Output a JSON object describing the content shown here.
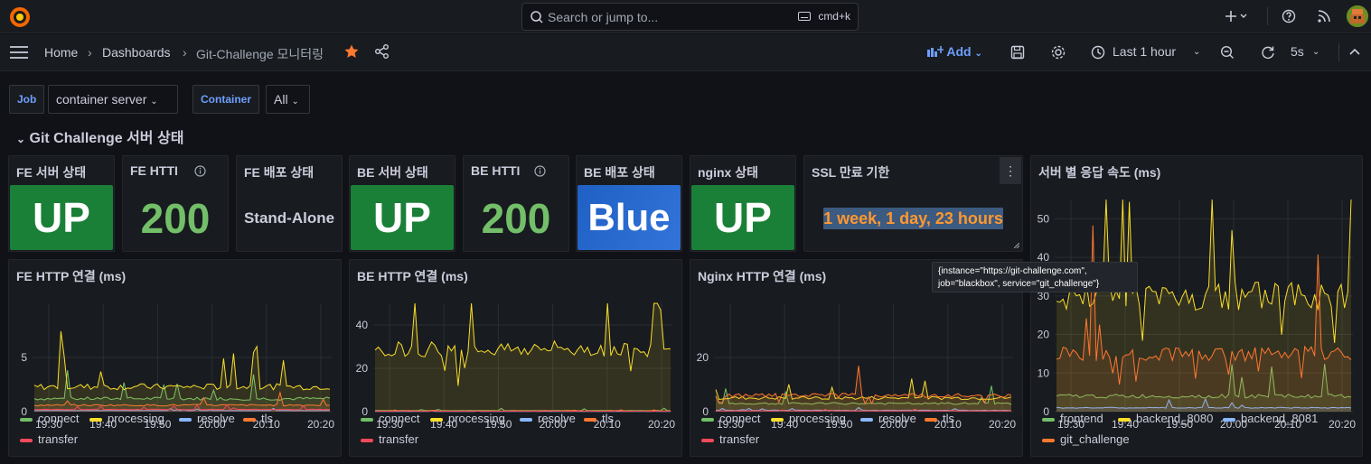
{
  "topbar": {
    "search_placeholder": "Search or jump to...",
    "shortcut": "cmd+k",
    "icons": [
      "grafana-logo-icon",
      "search-icon",
      "keyboard-icon",
      "plus-icon",
      "help-icon",
      "rss-icon",
      "avatar"
    ]
  },
  "nav": {
    "breadcrumb": [
      "Home",
      "Dashboards",
      "Git-Challenge 모니터링"
    ],
    "add_label": "Add",
    "time_range": "Last 1 hour",
    "refresh_interval": "5s"
  },
  "variables": [
    {
      "label": "Job",
      "value": "container server"
    },
    {
      "label": "Container",
      "value": "All"
    }
  ],
  "row_title": "Git Challenge 서버 상태",
  "stats": [
    {
      "title": "FE 서버 상태",
      "value": "UP",
      "bg": "#1a7f37"
    },
    {
      "title": "FE HTTI",
      "value": "200",
      "color": "#73bf69"
    },
    {
      "title": "FE 배포 상태",
      "value": "Stand-Alone",
      "color": "#ccccdc"
    },
    {
      "title": "BE 서버 상태",
      "value": "UP",
      "bg": "#1a7f37"
    },
    {
      "title": "BE HTTI",
      "value": "200",
      "color": "#73bf69"
    },
    {
      "title": "BE 배포 상태",
      "value": "Blue",
      "bg": "#1f60c4"
    },
    {
      "title": "nginx 상태",
      "value": "UP",
      "bg": "#1a7f37"
    },
    {
      "title": "SSL 만료 기한",
      "value": "1 week, 1 day, 23 hours",
      "color": "#ff9830"
    }
  ],
  "tooltip_text": [
    "{instance=\"https://git-challenge.com\",",
    "job=\"blackbox\", service=\"git_challenge\"}"
  ],
  "charts": [
    {
      "title": "FE HTTP 연결 (ms)",
      "legend": [
        "connect",
        "processing",
        "resolve",
        "tls",
        "transfer"
      ]
    },
    {
      "title": "BE HTTP 연결 (ms)",
      "legend": [
        "connect",
        "processing",
        "resolve",
        "tls",
        "transfer"
      ]
    },
    {
      "title": "Nginx HTTP 연결 (ms)",
      "legend": [
        "connect",
        "processing",
        "resolve",
        "tls",
        "transfer"
      ]
    },
    {
      "title": "서버 별 응답 속도 (ms)",
      "legend": [
        "frontend",
        "backend_8080",
        "backend_8081",
        "git_challenge"
      ]
    }
  ],
  "colors": {
    "connect": "#73bf69",
    "processing": "#fade2a",
    "resolve": "#8ab8ff",
    "tls": "#ff7830",
    "transfer": "#f2495c",
    "frontend": "#73bf69",
    "backend_8080": "#fade2a",
    "backend_8081": "#8ab8ff",
    "git_challenge": "#ff7830"
  },
  "chart_data": [
    {
      "type": "line",
      "title": "FE HTTP 연결 (ms)",
      "x": [
        "19:30",
        "19:40",
        "19:50",
        "20:00",
        "20:10",
        "20:20"
      ],
      "yticks": [
        0,
        5
      ],
      "ylim": [
        0,
        10
      ],
      "series": [
        {
          "name": "connect",
          "level": 1.2
        },
        {
          "name": "processing",
          "level": 2.3
        },
        {
          "name": "resolve",
          "level": 0.1
        },
        {
          "name": "tls",
          "level": 0.6
        },
        {
          "name": "transfer",
          "level": 0.2
        }
      ]
    },
    {
      "type": "line",
      "title": "BE HTTP 연결 (ms)",
      "x": [
        "19:30",
        "19:40",
        "19:50",
        "20:00",
        "20:10",
        "20:20"
      ],
      "yticks": [
        0,
        20,
        40
      ],
      "ylim": [
        0,
        50
      ],
      "series": [
        {
          "name": "connect",
          "level": 0.5
        },
        {
          "name": "processing",
          "level": 29
        },
        {
          "name": "resolve",
          "level": 0.1
        },
        {
          "name": "tls",
          "level": 0.3
        },
        {
          "name": "transfer",
          "level": 0.2
        }
      ]
    },
    {
      "type": "line",
      "title": "Nginx HTTP 연결 (ms)",
      "x": [
        "19:30",
        "19:40",
        "19:50",
        "20:00",
        "20:10",
        "20:20"
      ],
      "yticks": [
        0,
        20
      ],
      "ylim": [
        0,
        40
      ],
      "series": [
        {
          "name": "connect",
          "level": 3
        },
        {
          "name": "processing",
          "level": 5
        },
        {
          "name": "resolve",
          "level": 0.5
        },
        {
          "name": "tls",
          "level": 6
        },
        {
          "name": "transfer",
          "level": 0.3
        }
      ]
    },
    {
      "type": "line",
      "title": "서버 별 응답 속도 (ms)",
      "x": [
        "19:30",
        "19:40",
        "19:50",
        "20:00",
        "20:10",
        "20:20"
      ],
      "yticks": [
        0,
        10,
        20,
        30,
        40,
        50
      ],
      "ylim": [
        0,
        55
      ],
      "series": [
        {
          "name": "frontend",
          "level": 4
        },
        {
          "name": "backend_8080",
          "level": 30
        },
        {
          "name": "backend_8081",
          "level": 1
        },
        {
          "name": "git_challenge",
          "level": 15
        }
      ]
    }
  ]
}
